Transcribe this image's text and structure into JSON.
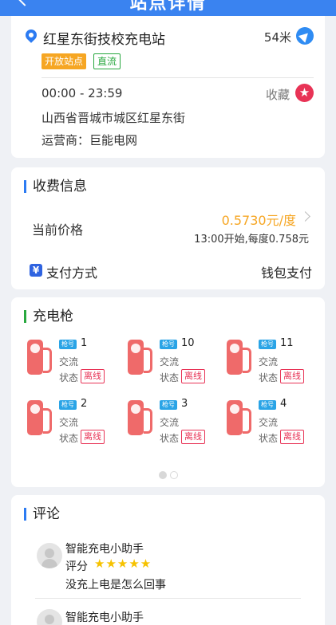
{
  "header": {
    "title": "站点详情"
  },
  "station": {
    "name": "红星东街技校充电站",
    "distance": "54米",
    "tags": {
      "open": "开放站点",
      "dc": "直流"
    },
    "hours": "00:00 - 23:59",
    "favorite_label": "收藏",
    "address": "山西省晋城市城区红星东街",
    "operator": "运营商：巨能电网"
  },
  "fees": {
    "title": "收费信息",
    "price_label": "当前价格",
    "price_value": "0.5730元/度",
    "price_note": "13:00开始,每度0.758元",
    "pay_label": "支付方式",
    "pay_value": "钱包支付",
    "pay_icon_glyph": "¥"
  },
  "guns": {
    "title": "充电枪",
    "badge": "枪号",
    "type_label": "交流",
    "status_label": "状态",
    "status_value": "离线",
    "items": [
      {
        "num": "1"
      },
      {
        "num": "10"
      },
      {
        "num": "11"
      },
      {
        "num": "2"
      },
      {
        "num": "3"
      },
      {
        "num": "4"
      }
    ],
    "pager": {
      "current": 1,
      "total": 2
    }
  },
  "comments": {
    "title": "评论",
    "rating_label": "评分",
    "items": [
      {
        "user": "智能充电小助手",
        "stars": "★★★★★",
        "text": "没充上电是怎么回事"
      },
      {
        "user": "智能充电小助手"
      }
    ]
  },
  "colors": {
    "header": "#3a83f0",
    "accent_orange": "#f6a623",
    "status_red": "#e83356",
    "pump_red": "#ef6a6a",
    "dc_green": "#29a83f"
  },
  "icons": {
    "back": "back-arrow-icon",
    "location": "location-pin-icon",
    "navigate": "navigate-icon",
    "favorite": "star-icon",
    "payment": "yen-icon",
    "pump": "charging-pump-icon",
    "avatar": "avatar-icon"
  }
}
